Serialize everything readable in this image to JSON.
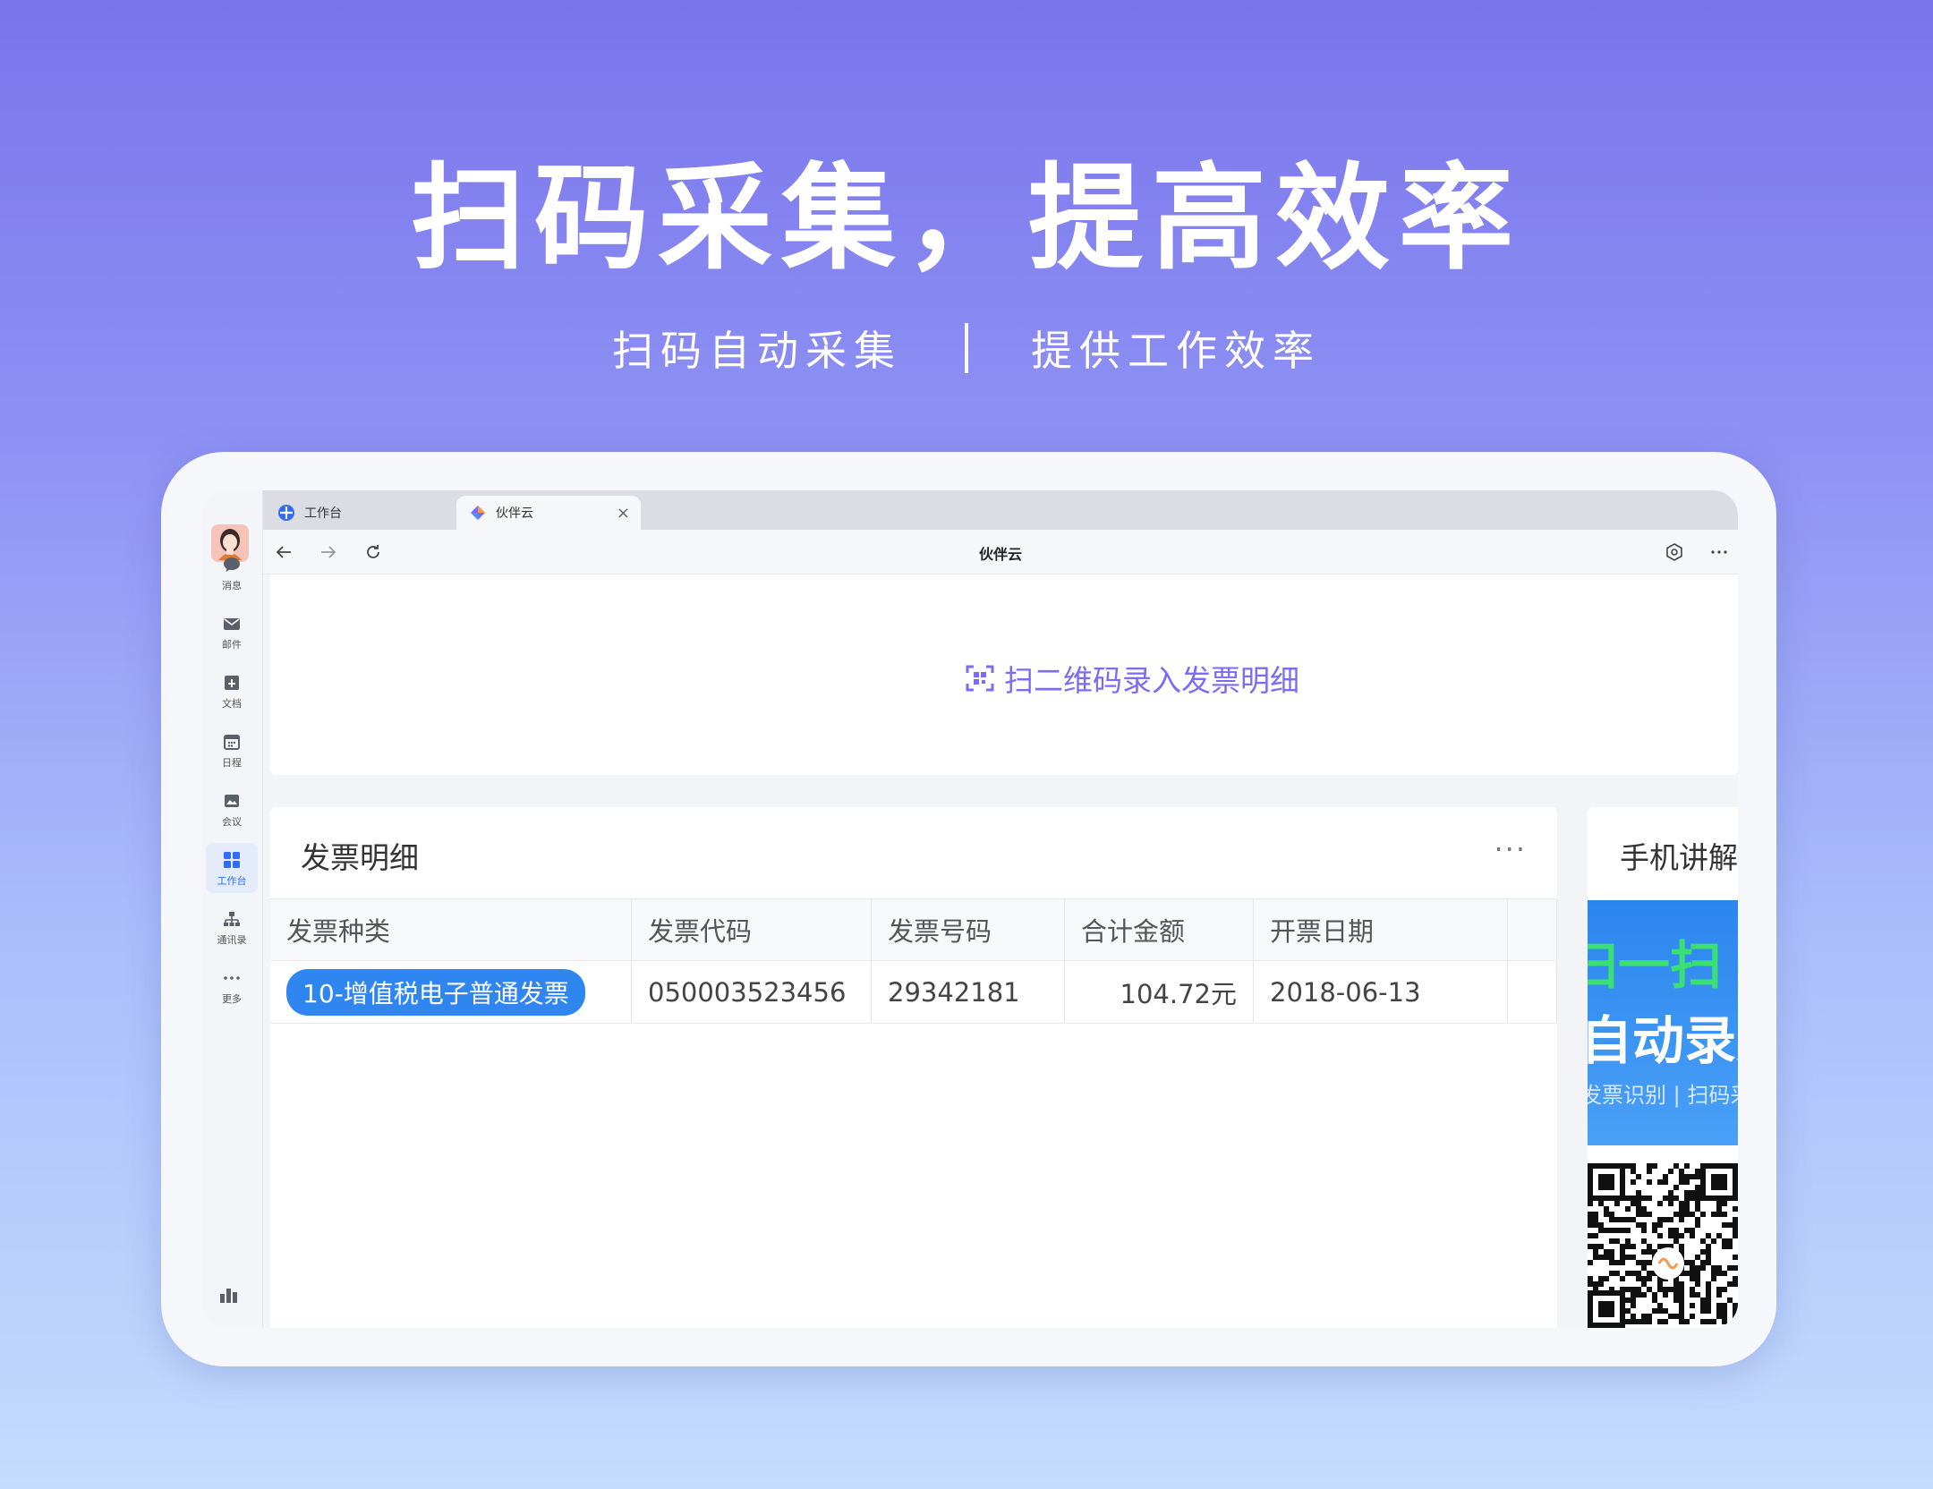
{
  "hero": {
    "title": "扫码采集，提高效率",
    "sub_left": "扫码自动采集",
    "sub_right": "提供工作效率"
  },
  "rail": {
    "items": [
      {
        "label": "消息",
        "icon": "chat-icon"
      },
      {
        "label": "邮件",
        "icon": "mail-icon"
      },
      {
        "label": "文档",
        "icon": "doc-icon"
      },
      {
        "label": "日程",
        "icon": "calendar-icon"
      },
      {
        "label": "会议",
        "icon": "meeting-icon"
      },
      {
        "label": "工作台",
        "icon": "workbench-icon",
        "active": true
      },
      {
        "label": "通讯录",
        "icon": "contacts-icon"
      },
      {
        "label": "更多",
        "icon": "more-icon"
      }
    ]
  },
  "browser": {
    "tab1": "工作台",
    "tab2": "伙伴云",
    "close": "×",
    "title": "伙伴云"
  },
  "scan": {
    "label": "扫二维码录入发票明细"
  },
  "invoice": {
    "title": "发票明细",
    "more": "···",
    "columns": [
      "发票种类",
      "发票代码",
      "发票号码",
      "合计金额",
      "开票日期"
    ],
    "row": {
      "type": "10-增值税电子普通发票",
      "code": "050003523456",
      "number": "29342181",
      "amount": "104.72元",
      "date": "2018-06-13"
    }
  },
  "side": {
    "title": "手机讲解",
    "promo_line1": "扫一扫",
    "promo_line2": "自动录入",
    "promo_line3": "发票识别 | 扫码采集"
  },
  "colors": {
    "accent": "#2f6df6",
    "scan_link": "#7c6cf4",
    "pill": "#2f86f0"
  }
}
